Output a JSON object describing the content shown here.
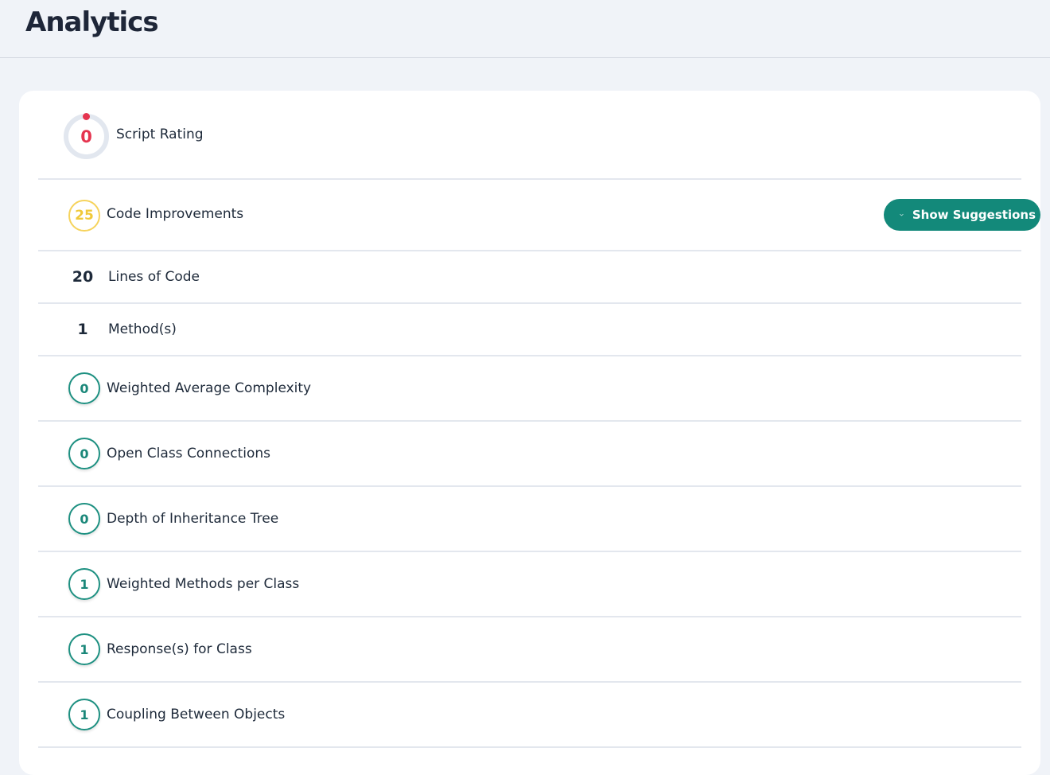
{
  "header": {
    "title": "Analytics"
  },
  "script_rating": {
    "value": "0",
    "label": "Script Rating"
  },
  "code_improvements": {
    "value": "25",
    "label": "Code Improvements",
    "button_label": "Show Suggestions",
    "button_icon": "chevron-down-icon"
  },
  "lines_of_code": {
    "value": "20",
    "label": "Lines of Code"
  },
  "methods": {
    "value": "1",
    "label": "Method(s)"
  },
  "metrics": [
    {
      "value": "0",
      "label": "Weighted Average Complexity"
    },
    {
      "value": "0",
      "label": "Open Class Connections"
    },
    {
      "value": "0",
      "label": "Depth of Inheritance Tree"
    },
    {
      "value": "1",
      "label": "Weighted Methods per Class"
    },
    {
      "value": "1",
      "label": "Response(s) for Class"
    },
    {
      "value": "1",
      "label": "Coupling Between Objects"
    }
  ],
  "colors": {
    "accent": "#13897a",
    "rating": "#e5344f",
    "warning": "#f6d35c",
    "background": "#f0f3f8"
  }
}
